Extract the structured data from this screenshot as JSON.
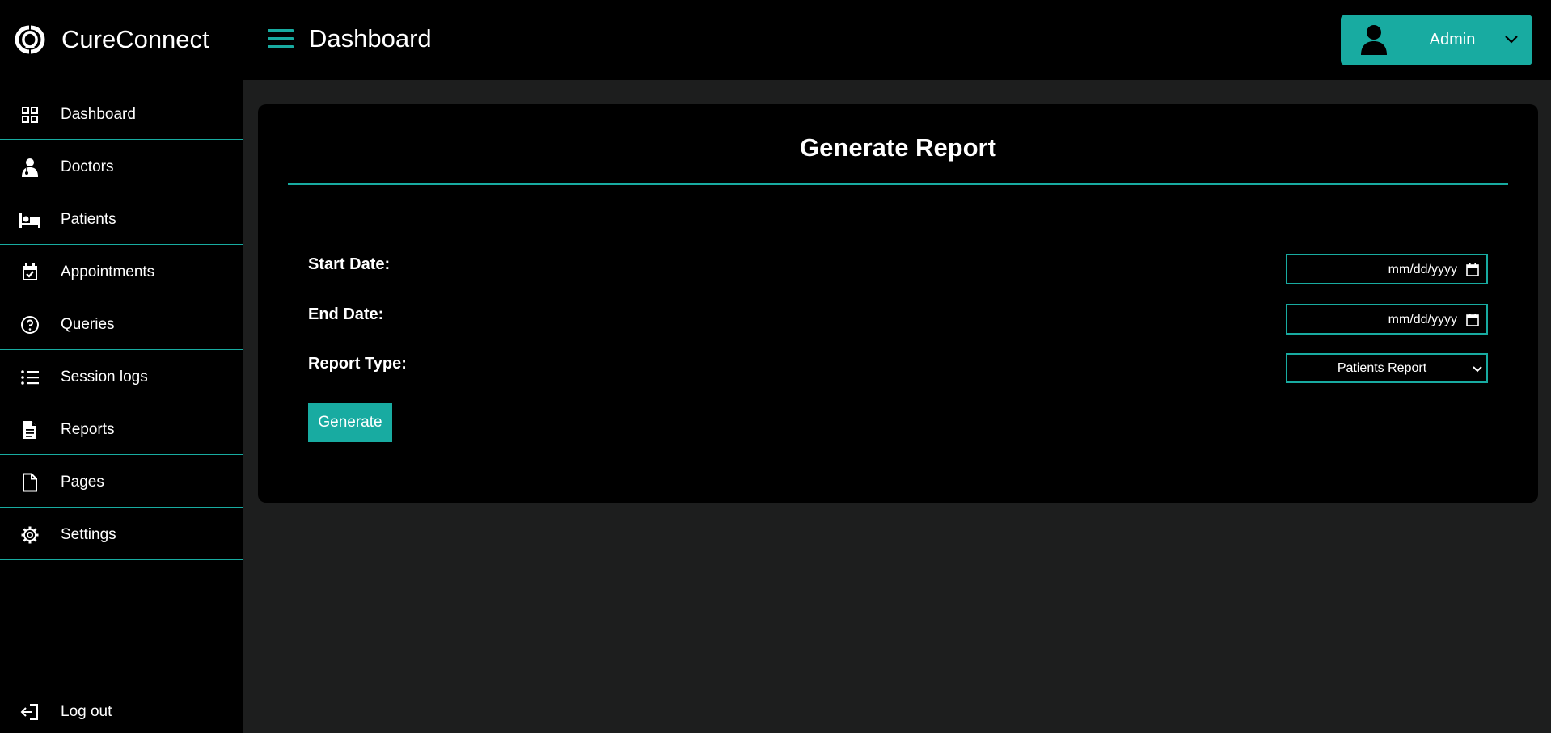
{
  "app": {
    "name": "CureConnect"
  },
  "header": {
    "title": "Dashboard"
  },
  "user_menu": {
    "label": "Admin"
  },
  "sidebar": {
    "items": [
      {
        "label": "Dashboard",
        "icon": "grid-icon"
      },
      {
        "label": "Doctors",
        "icon": "doctor-icon"
      },
      {
        "label": "Patients",
        "icon": "bed-icon"
      },
      {
        "label": "Appointments",
        "icon": "calendar-check-icon"
      },
      {
        "label": "Queries",
        "icon": "question-circle-icon"
      },
      {
        "label": "Session logs",
        "icon": "list-icon"
      },
      {
        "label": "Reports",
        "icon": "file-text-icon"
      },
      {
        "label": "Pages",
        "icon": "file-icon"
      },
      {
        "label": "Settings",
        "icon": "gear-icon"
      }
    ],
    "logout": {
      "label": "Log out",
      "icon": "logout-icon"
    }
  },
  "report_form": {
    "title": "Generate Report",
    "start_date": {
      "label": "Start Date:",
      "placeholder": "mm/dd/yyyy"
    },
    "end_date": {
      "label": "End Date:",
      "placeholder": "mm/dd/yyyy"
    },
    "report_type": {
      "label": "Report Type:",
      "selected": "Patients Report"
    },
    "generate_label": "Generate"
  },
  "colors": {
    "accent": "#18aba1",
    "background": "#000000",
    "content_background": "#1d1e1e",
    "text": "#ffffff"
  }
}
